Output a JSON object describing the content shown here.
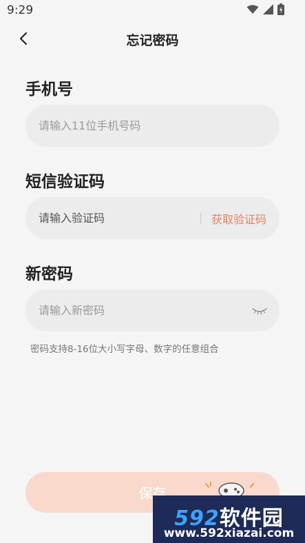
{
  "status_bar": {
    "time": "9:29",
    "icons": [
      "wifi-icon",
      "signal-icon",
      "battery-icon"
    ]
  },
  "nav": {
    "title": "忘记密码",
    "back_icon": "chevron-left-icon"
  },
  "phone": {
    "label": "手机号",
    "placeholder": "请输入11位手机号码",
    "value": ""
  },
  "sms_code": {
    "label": "短信验证码",
    "placeholder": "请输入验证码",
    "value": "",
    "get_code_label": "获取验证码"
  },
  "new_password": {
    "label": "新密码",
    "placeholder": "请输入新密码",
    "value": "",
    "toggle_icon": "eye-closed-icon",
    "hint": "密码支持8-16位大小写字母、数字的任意组合"
  },
  "save_button": {
    "label": "保存"
  },
  "watermark": {
    "logo_number": "592",
    "logo_text": "软件园",
    "url": "www.592xiazai.com"
  },
  "colors": {
    "background": "#f5f5f5",
    "field_background": "#ececec",
    "accent": "#e8805f",
    "save_button_background": "#f8d9cc"
  }
}
